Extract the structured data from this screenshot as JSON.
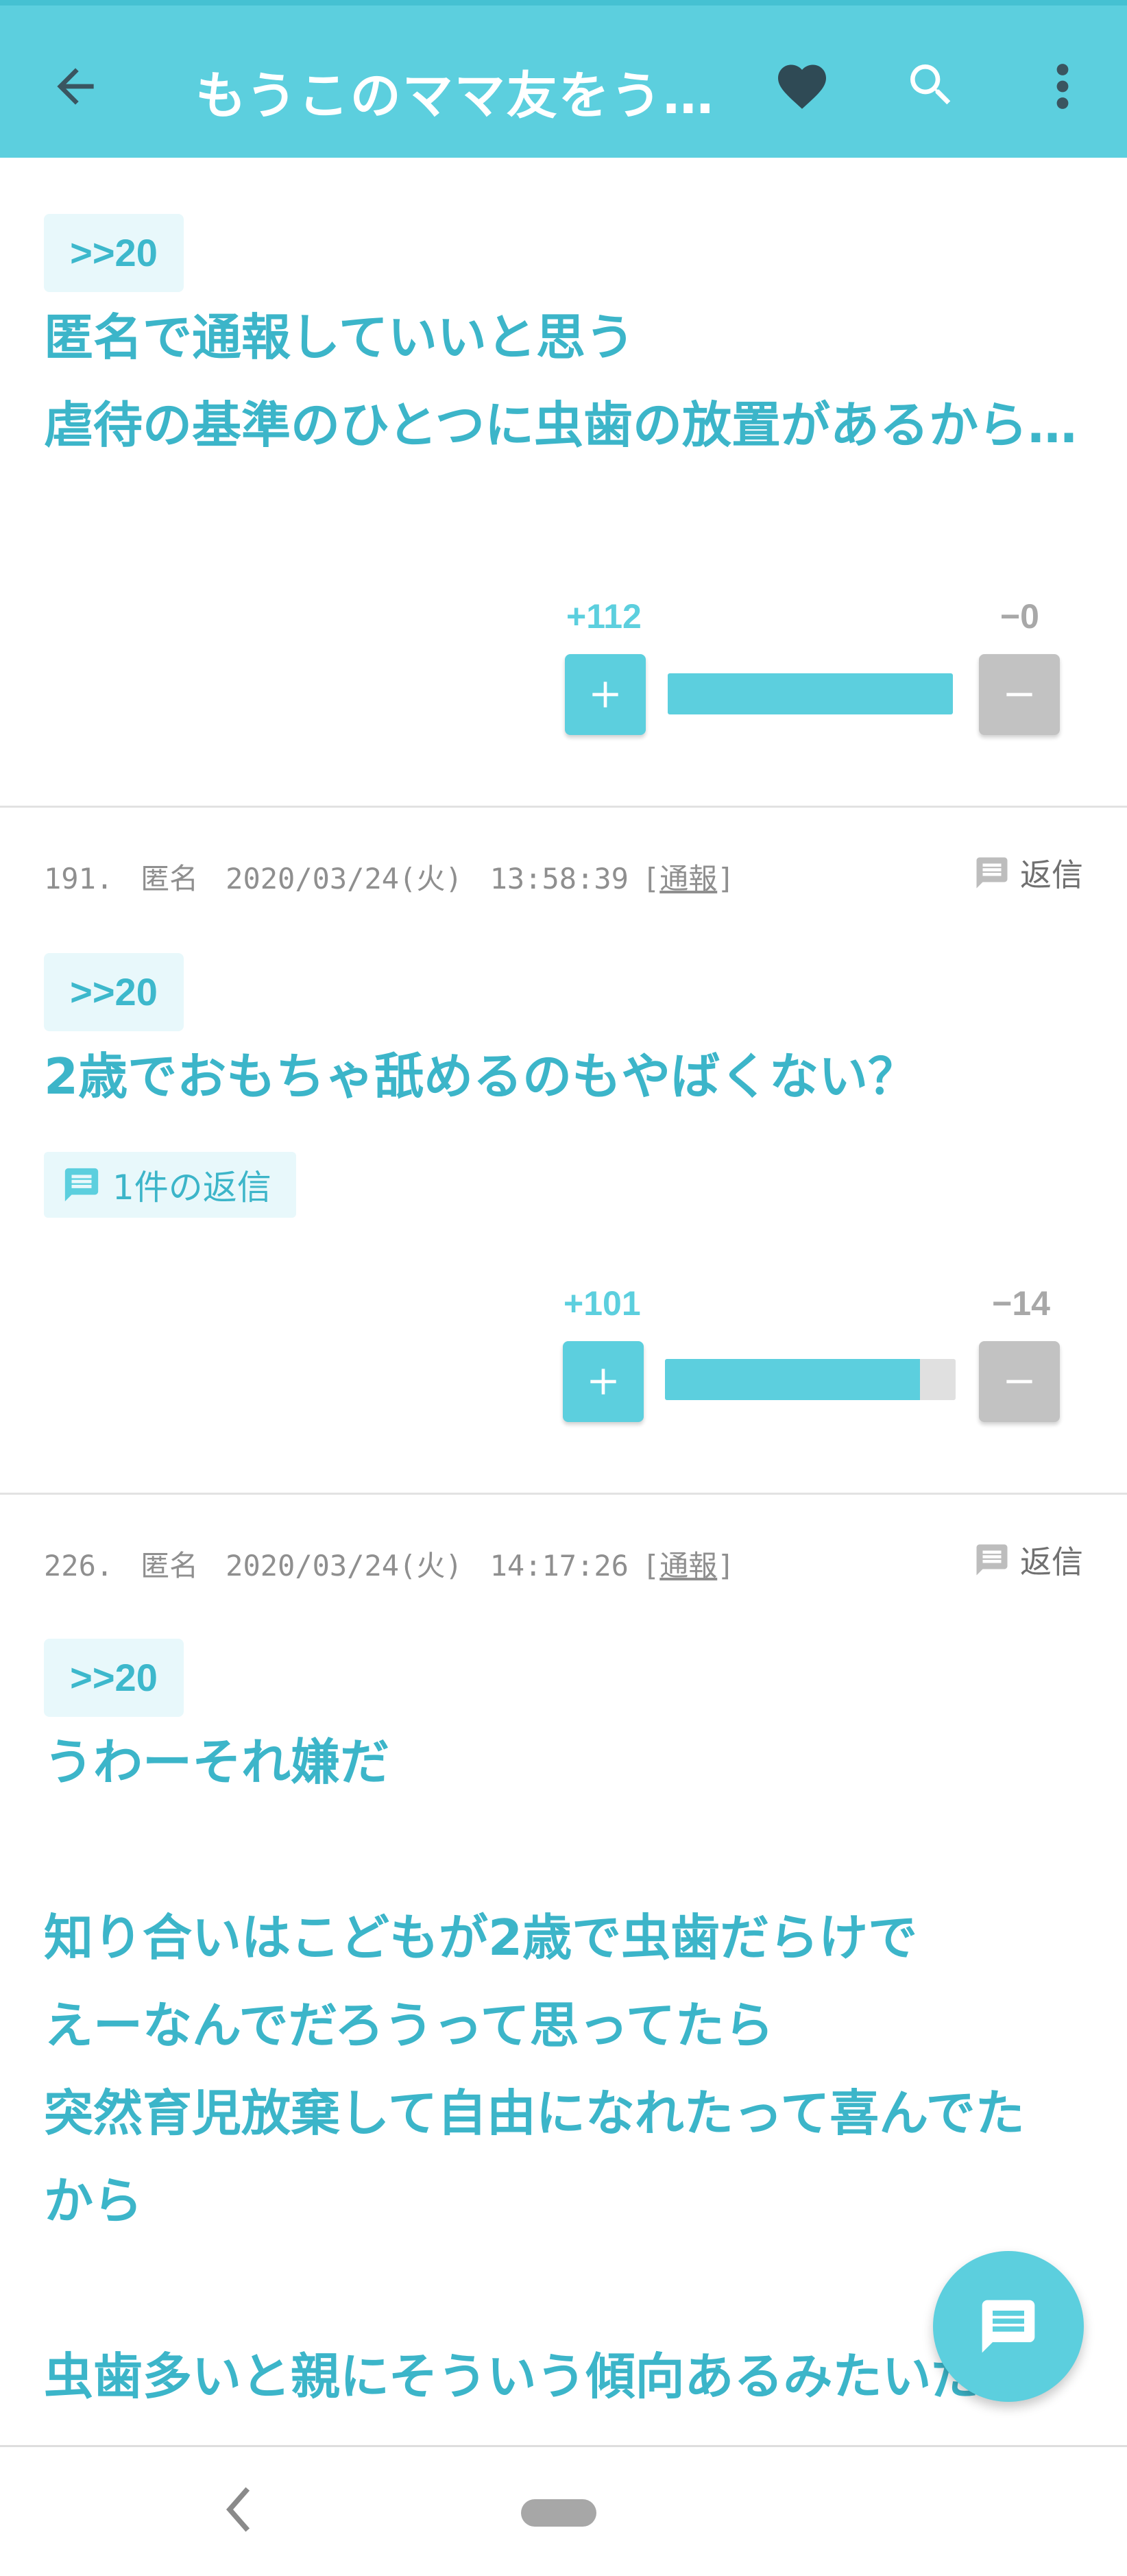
{
  "header": {
    "title": "もうこのママ友をう…",
    "back_icon": "arrow-back-icon",
    "favorite_icon": "heart-icon",
    "search_icon": "search-icon",
    "menu_icon": "more-vert-icon",
    "bg_color": "#5ccfde"
  },
  "comments": [
    {
      "anchor": ">>20",
      "text": "匿名で通報していいと思う\n虐待の基準のひとつに虫歯の放置があるから…",
      "plus_label": "+112",
      "minus_label": "−0",
      "plus_ratio": 1.0
    },
    {
      "number": "191.",
      "name": "匿名",
      "date": "2020/03/24(火)",
      "time": "13:58:39",
      "report_open": "[",
      "report_label": "通報",
      "report_close": "]",
      "reply_label": "返信",
      "anchor": ">>20",
      "text": "2歳でおもちゃ舐めるのもやばくない？",
      "reply_count_label": "1件の返信",
      "plus_label": "+101",
      "minus_label": "−14",
      "plus_ratio": 0.878
    },
    {
      "number": "226.",
      "name": "匿名",
      "date": "2020/03/24(火)",
      "time": "14:17:26",
      "report_open": "[",
      "report_label": "通報",
      "report_close": "]",
      "reply_label": "返信",
      "anchor": ">>20",
      "text": "うわーそれ嫌だ\n\n知り合いはこどもが2歳で虫歯だらけで\nえーなんでだろうって思ってたら\n突然育児放棄して自由になれたって喜んでたから\n\n虫歯多いと親にそういう傾向あるみたいだ"
    }
  ],
  "fab": {
    "icon": "comment-icon"
  },
  "navbar": {
    "back_icon": "nav-back-icon",
    "home_icon": "home-pill-icon"
  },
  "colors": {
    "accent": "#5ccfde",
    "text_accent": "#3cb5c9",
    "minus": "#c2c2c2"
  }
}
